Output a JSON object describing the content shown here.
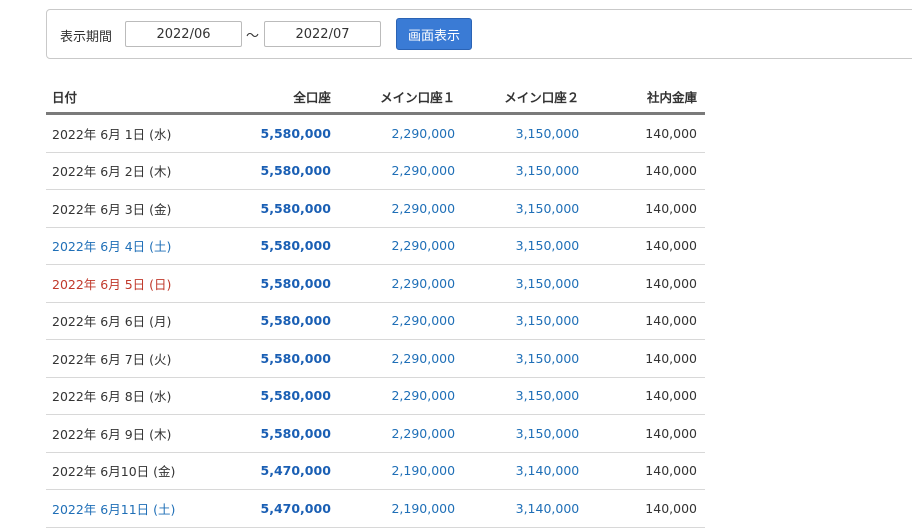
{
  "filter": {
    "label": "表示期間",
    "from_value": "2022/06",
    "separator": "〜",
    "to_value": "2022/07",
    "submit_label": "画面表示"
  },
  "table": {
    "headers": {
      "date": "日付",
      "total": "全口座",
      "main1": "メイン口座１",
      "main2": "メイン口座２",
      "safe": "社内金庫"
    },
    "rows": [
      {
        "date": "2022年 6月 1日 (水)",
        "day_type": "weekday",
        "total": "5,580,000",
        "main1": "2,290,000",
        "main2": "3,150,000",
        "safe": "140,000"
      },
      {
        "date": "2022年 6月 2日 (木)",
        "day_type": "weekday",
        "total": "5,580,000",
        "main1": "2,290,000",
        "main2": "3,150,000",
        "safe": "140,000"
      },
      {
        "date": "2022年 6月 3日 (金)",
        "day_type": "weekday",
        "total": "5,580,000",
        "main1": "2,290,000",
        "main2": "3,150,000",
        "safe": "140,000"
      },
      {
        "date": "2022年 6月 4日 (土)",
        "day_type": "saturday",
        "total": "5,580,000",
        "main1": "2,290,000",
        "main2": "3,150,000",
        "safe": "140,000"
      },
      {
        "date": "2022年 6月 5日 (日)",
        "day_type": "sunday",
        "total": "5,580,000",
        "main1": "2,290,000",
        "main2": "3,150,000",
        "safe": "140,000"
      },
      {
        "date": "2022年 6月 6日 (月)",
        "day_type": "weekday",
        "total": "5,580,000",
        "main1": "2,290,000",
        "main2": "3,150,000",
        "safe": "140,000"
      },
      {
        "date": "2022年 6月 7日 (火)",
        "day_type": "weekday",
        "total": "5,580,000",
        "main1": "2,290,000",
        "main2": "3,150,000",
        "safe": "140,000"
      },
      {
        "date": "2022年 6月 8日 (水)",
        "day_type": "weekday",
        "total": "5,580,000",
        "main1": "2,290,000",
        "main2": "3,150,000",
        "safe": "140,000"
      },
      {
        "date": "2022年 6月 9日 (木)",
        "day_type": "weekday",
        "total": "5,580,000",
        "main1": "2,290,000",
        "main2": "3,150,000",
        "safe": "140,000"
      },
      {
        "date": "2022年 6月10日 (金)",
        "day_type": "weekday",
        "total": "5,470,000",
        "main1": "2,190,000",
        "main2": "3,140,000",
        "safe": "140,000"
      },
      {
        "date": "2022年 6月11日 (土)",
        "day_type": "saturday",
        "total": "5,470,000",
        "main1": "2,190,000",
        "main2": "3,140,000",
        "safe": "140,000"
      }
    ]
  },
  "colors": {
    "saturday": "#1f6fb7",
    "sunday": "#c0392b",
    "total": "#1a5fb4",
    "button": "#3a7bd5"
  }
}
